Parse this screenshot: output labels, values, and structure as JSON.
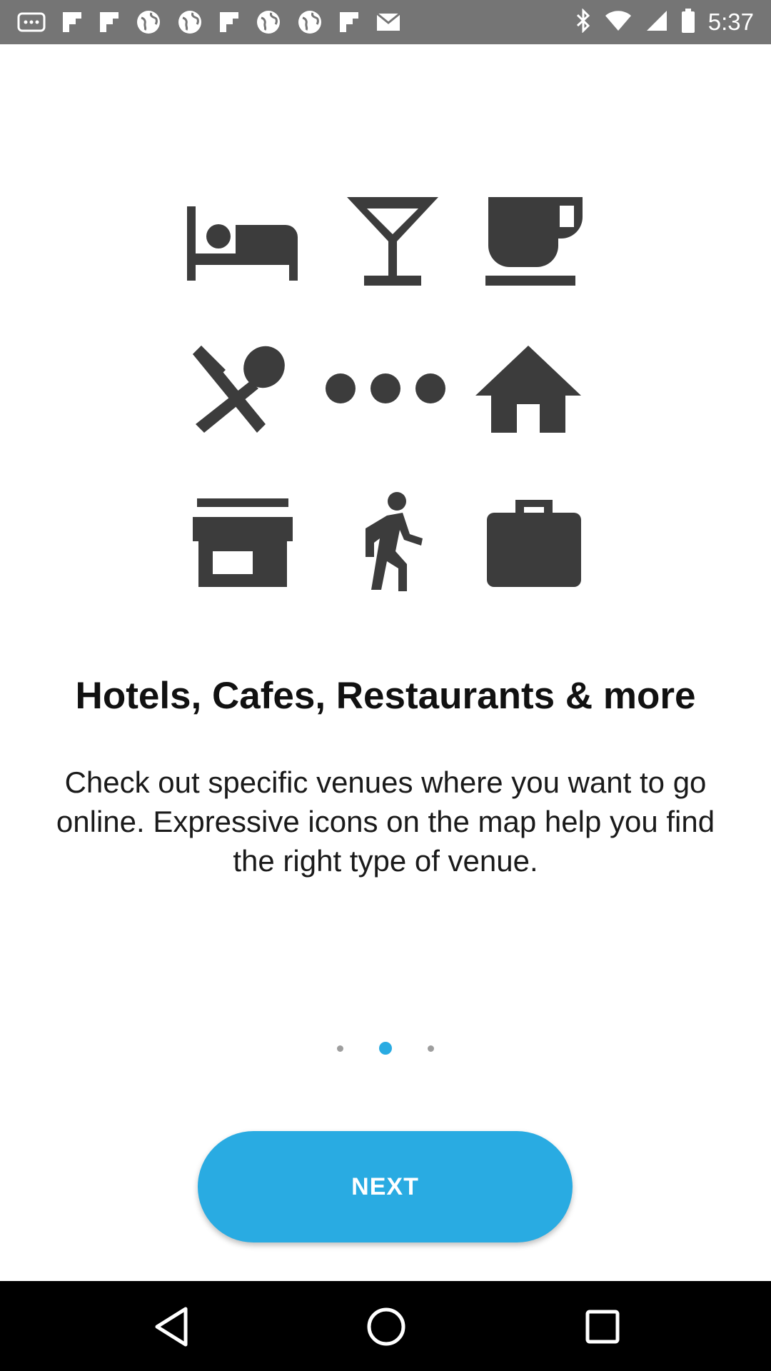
{
  "status_bar": {
    "time": "5:37",
    "left_icons": [
      "more-icon",
      "flipboard-icon",
      "flipboard-icon",
      "globe-icon",
      "globe-icon",
      "flipboard-icon",
      "globe-icon",
      "globe-icon",
      "flipboard-icon",
      "mail-icon"
    ],
    "right_icons": [
      "bluetooth-icon",
      "wifi-icon",
      "signal-icon",
      "battery-icon"
    ]
  },
  "venue_icons": [
    "bed-icon",
    "cocktail-icon",
    "coffee-cup-icon",
    "fork-spoon-icon",
    "more-dots-icon",
    "home-icon",
    "storefront-icon",
    "walking-person-icon",
    "briefcase-icon"
  ],
  "onboarding": {
    "title": "Hotels, Cafes, Restaurants & more",
    "description": "Check out specific venues where you want to go online. Expressive icons on the map help you find the right type of venue.",
    "page_count": 3,
    "current_page": 2,
    "next_label": "NEXT"
  },
  "colors": {
    "accent": "#29abe2",
    "icon": "#3c3c3c",
    "status_bar": "#757575",
    "nav_bar": "#000000"
  },
  "nav_bar": {
    "buttons": [
      "back-icon",
      "home-icon",
      "recents-icon"
    ]
  }
}
